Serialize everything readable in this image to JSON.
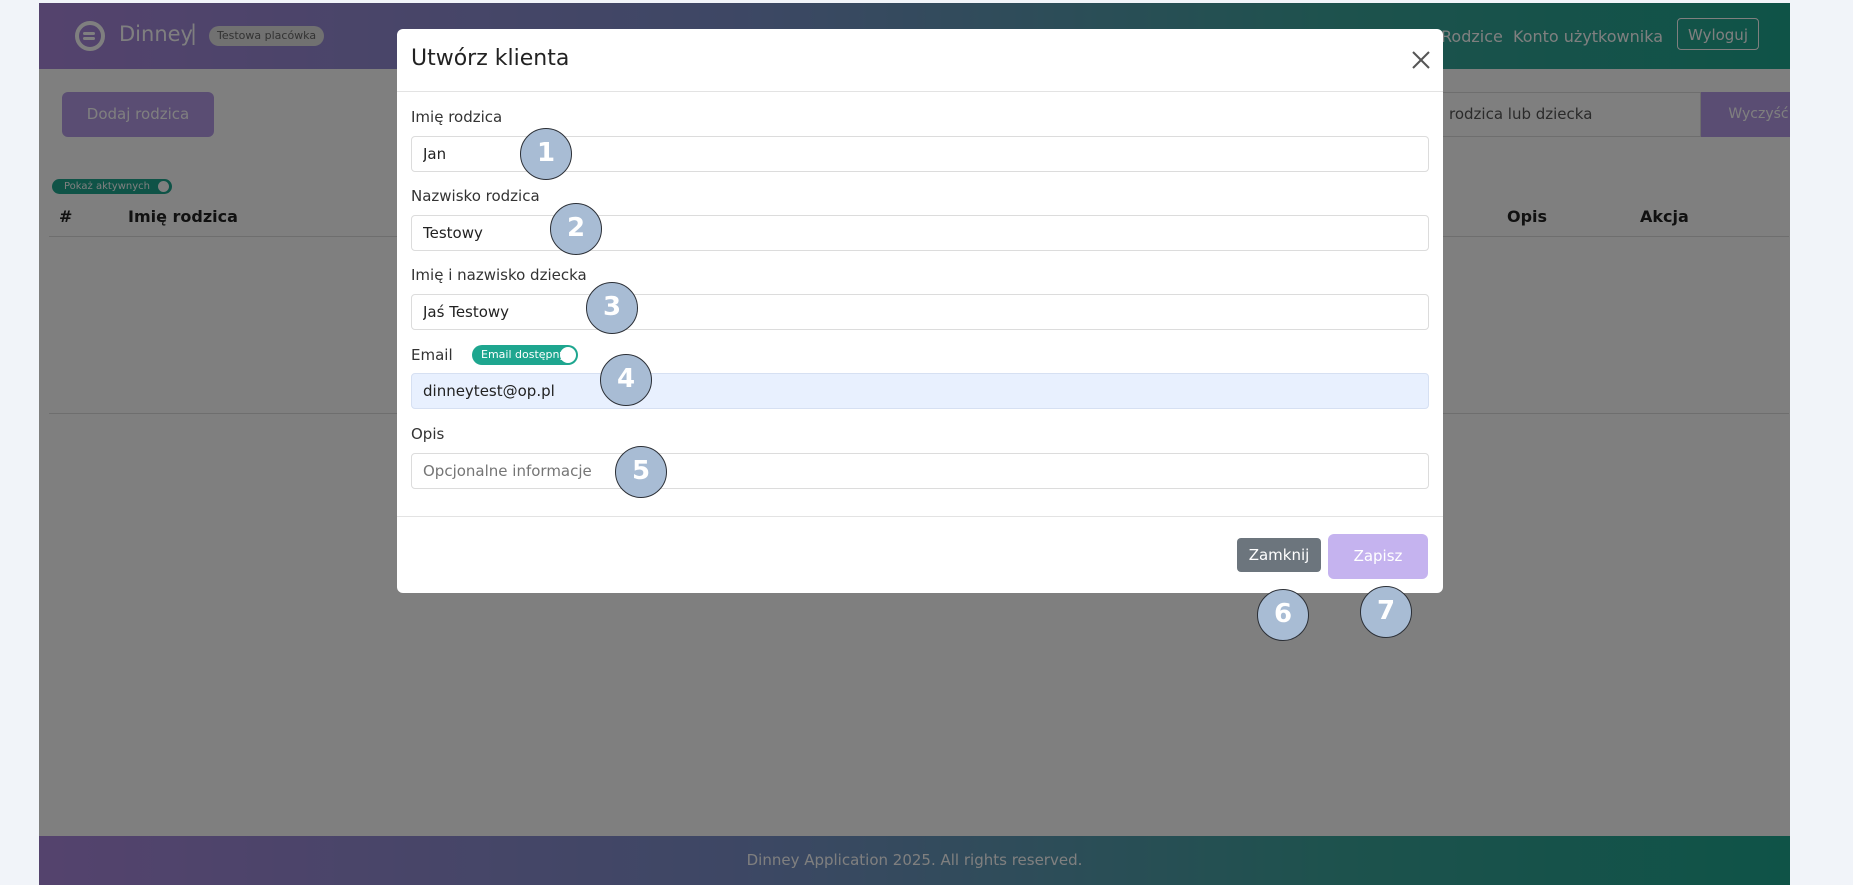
{
  "header": {
    "brand": "Dinney",
    "brand_separator": "|",
    "facility_badge": "Testowa placówka",
    "nav": {
      "parents": "Rodzice",
      "account": "Konto użytkownika"
    },
    "logout_label": "Wyloguj"
  },
  "toolbar": {
    "add_parent_label": "Dodaj rodzica",
    "search_placeholder": "rodzica lub dziecka",
    "clear_label": "Wyczyść"
  },
  "table": {
    "active_toggle_label": "Pokaż aktywnych",
    "columns": {
      "index": "#",
      "parent_name": "Imię rodzica",
      "description": "Opis",
      "action": "Akcja"
    }
  },
  "footer": {
    "text": "Dinney Application 2025. All rights reserved."
  },
  "modal": {
    "title": "Utwórz klienta",
    "fields": {
      "parent_first_name": {
        "label": "Imię rodzica",
        "value": "Jan"
      },
      "parent_last_name": {
        "label": "Nazwisko rodzica",
        "value": "Testowy"
      },
      "child_name": {
        "label": "Imię i nazwisko dziecka",
        "value": "Jaś Testowy"
      },
      "email": {
        "label": "Email",
        "toggle_label": "Email dostępny",
        "value": "dinneytest@op.pl"
      },
      "description": {
        "label": "Opis",
        "placeholder": "Opcjonalne informacje"
      }
    },
    "close_label": "Zamknij",
    "save_label": "Zapisz"
  },
  "step_markers": [
    "1",
    "2",
    "3",
    "4",
    "5",
    "6",
    "7"
  ],
  "colors": {
    "brand_purple": "#b49be6",
    "brand_teal": "#1ea68f",
    "secondary_gray": "#6c757d",
    "marker_fill": "#a8bcd4"
  }
}
